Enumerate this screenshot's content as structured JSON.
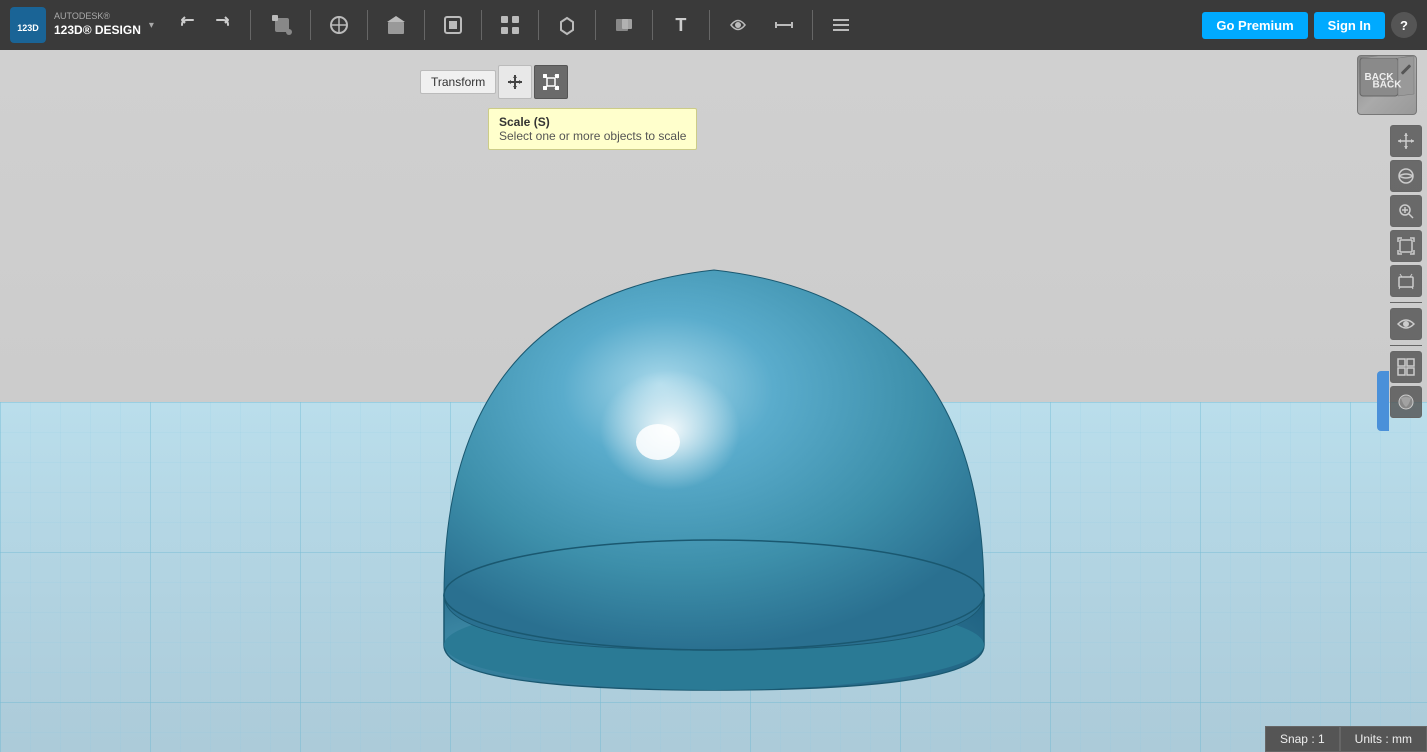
{
  "app": {
    "brand_top": "AUTODESK®",
    "brand_bottom": "123D® DESIGN",
    "logo_arrow": "▾"
  },
  "toolbar": {
    "undo_label": "↩",
    "redo_label": "↪",
    "tools": [
      {
        "name": "primitive",
        "icon": "⬡",
        "title": "Primitives"
      },
      {
        "name": "sketch",
        "icon": "✏",
        "title": "Sketch"
      },
      {
        "name": "construct",
        "icon": "⬛",
        "title": "Construct"
      },
      {
        "name": "modify",
        "icon": "⬚",
        "title": "Modify"
      },
      {
        "name": "pattern",
        "icon": "⠿",
        "title": "Pattern"
      },
      {
        "name": "group",
        "icon": "◈",
        "title": "Group"
      },
      {
        "name": "combine",
        "icon": "⧉",
        "title": "Combine"
      },
      {
        "name": "text",
        "icon": "T",
        "title": "Text"
      },
      {
        "name": "snap",
        "icon": "🔗",
        "title": "Snap"
      },
      {
        "name": "measure",
        "icon": "📐",
        "title": "Measure"
      },
      {
        "name": "layers",
        "icon": "≡",
        "title": "Layers"
      }
    ],
    "premium_label": "Go Premium",
    "signin_label": "Sign In",
    "help_label": "?"
  },
  "transform": {
    "label": "Transform",
    "move_title": "Move",
    "scale_title": "Scale"
  },
  "tooltip": {
    "title": "Scale (S)",
    "description": "Select one or more objects to scale"
  },
  "nav_cube": {
    "label": "BACK"
  },
  "viewport_controls": [
    {
      "name": "pan",
      "icon": "+",
      "title": "Pan"
    },
    {
      "name": "orbit",
      "icon": "↻",
      "title": "Orbit"
    },
    {
      "name": "zoom",
      "icon": "🔍",
      "title": "Zoom"
    },
    {
      "name": "fit",
      "icon": "⊡",
      "title": "Fit All"
    },
    {
      "name": "perspective",
      "icon": "◱",
      "title": "Perspective"
    },
    {
      "name": "eye",
      "icon": "👁",
      "title": "View Options"
    },
    {
      "name": "grid",
      "icon": "⊞",
      "title": "Grid"
    },
    {
      "name": "material",
      "icon": "◉",
      "title": "Material"
    }
  ],
  "statusbar": {
    "snap_label": "Snap : 1",
    "units_label": "Units : mm"
  }
}
